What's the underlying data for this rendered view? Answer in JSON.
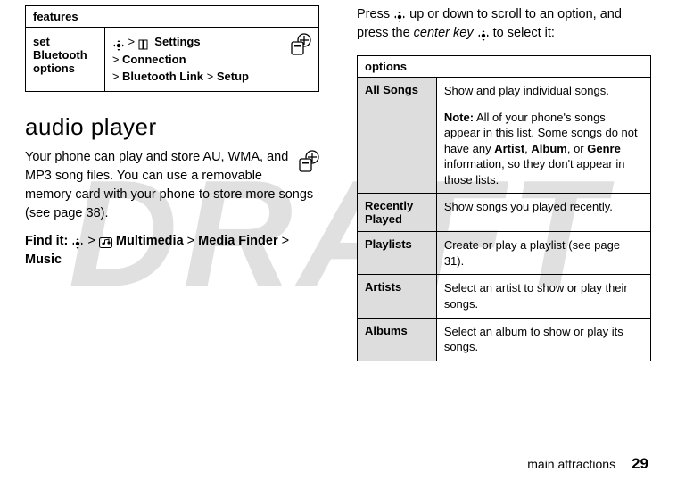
{
  "watermark": "DRAFT",
  "left": {
    "features_table": {
      "header": "features",
      "row": {
        "label": "set Bluetooth options",
        "sep1": " > ",
        "p1": "Settings",
        "sep2": ">",
        "p2": "Connection",
        "sep3": ">",
        "p3": "Bluetooth Link",
        "sep4": " > ",
        "p4": "Setup"
      }
    },
    "section_heading": "audio player",
    "intro_text": "Your phone can play and store AU, WMA, and MP3 song files. You can use a removable memory card with your phone to store more songs (see page 38).",
    "find_it": {
      "label": "Find it: ",
      "sep1": " > ",
      "p1": "Multimedia",
      "sep2": " > ",
      "p2": "Media Finder",
      "sep3": " > ",
      "p3": "Music"
    }
  },
  "right": {
    "intro": {
      "pre": "Press ",
      "mid": " up or down to scroll to an option, and press the ",
      "center_key": "center key",
      "post": " to select it:"
    },
    "options_table": {
      "header": "options",
      "rows": [
        {
          "label": "All Songs",
          "desc": "Show and play individual songs.",
          "note_label": "Note:",
          "note_a": " All of your phone's songs appear in this list. Some songs do not have any ",
          "k1": "Artist",
          "comma1": ", ",
          "k2": "Album",
          "comma2": ", or ",
          "k3": "Genre",
          "note_b": " information, so they don't appear in those lists."
        },
        {
          "label": "Recently Played",
          "desc": "Show songs you played recently."
        },
        {
          "label": "Playlists",
          "desc": "Create or play a playlist (see page 31)."
        },
        {
          "label": "Artists",
          "desc": "Select an artist to show or play their songs."
        },
        {
          "label": "Albums",
          "desc": "Select an album to show or play its songs."
        }
      ]
    }
  },
  "footer": {
    "section": "main attractions",
    "page": "29"
  }
}
